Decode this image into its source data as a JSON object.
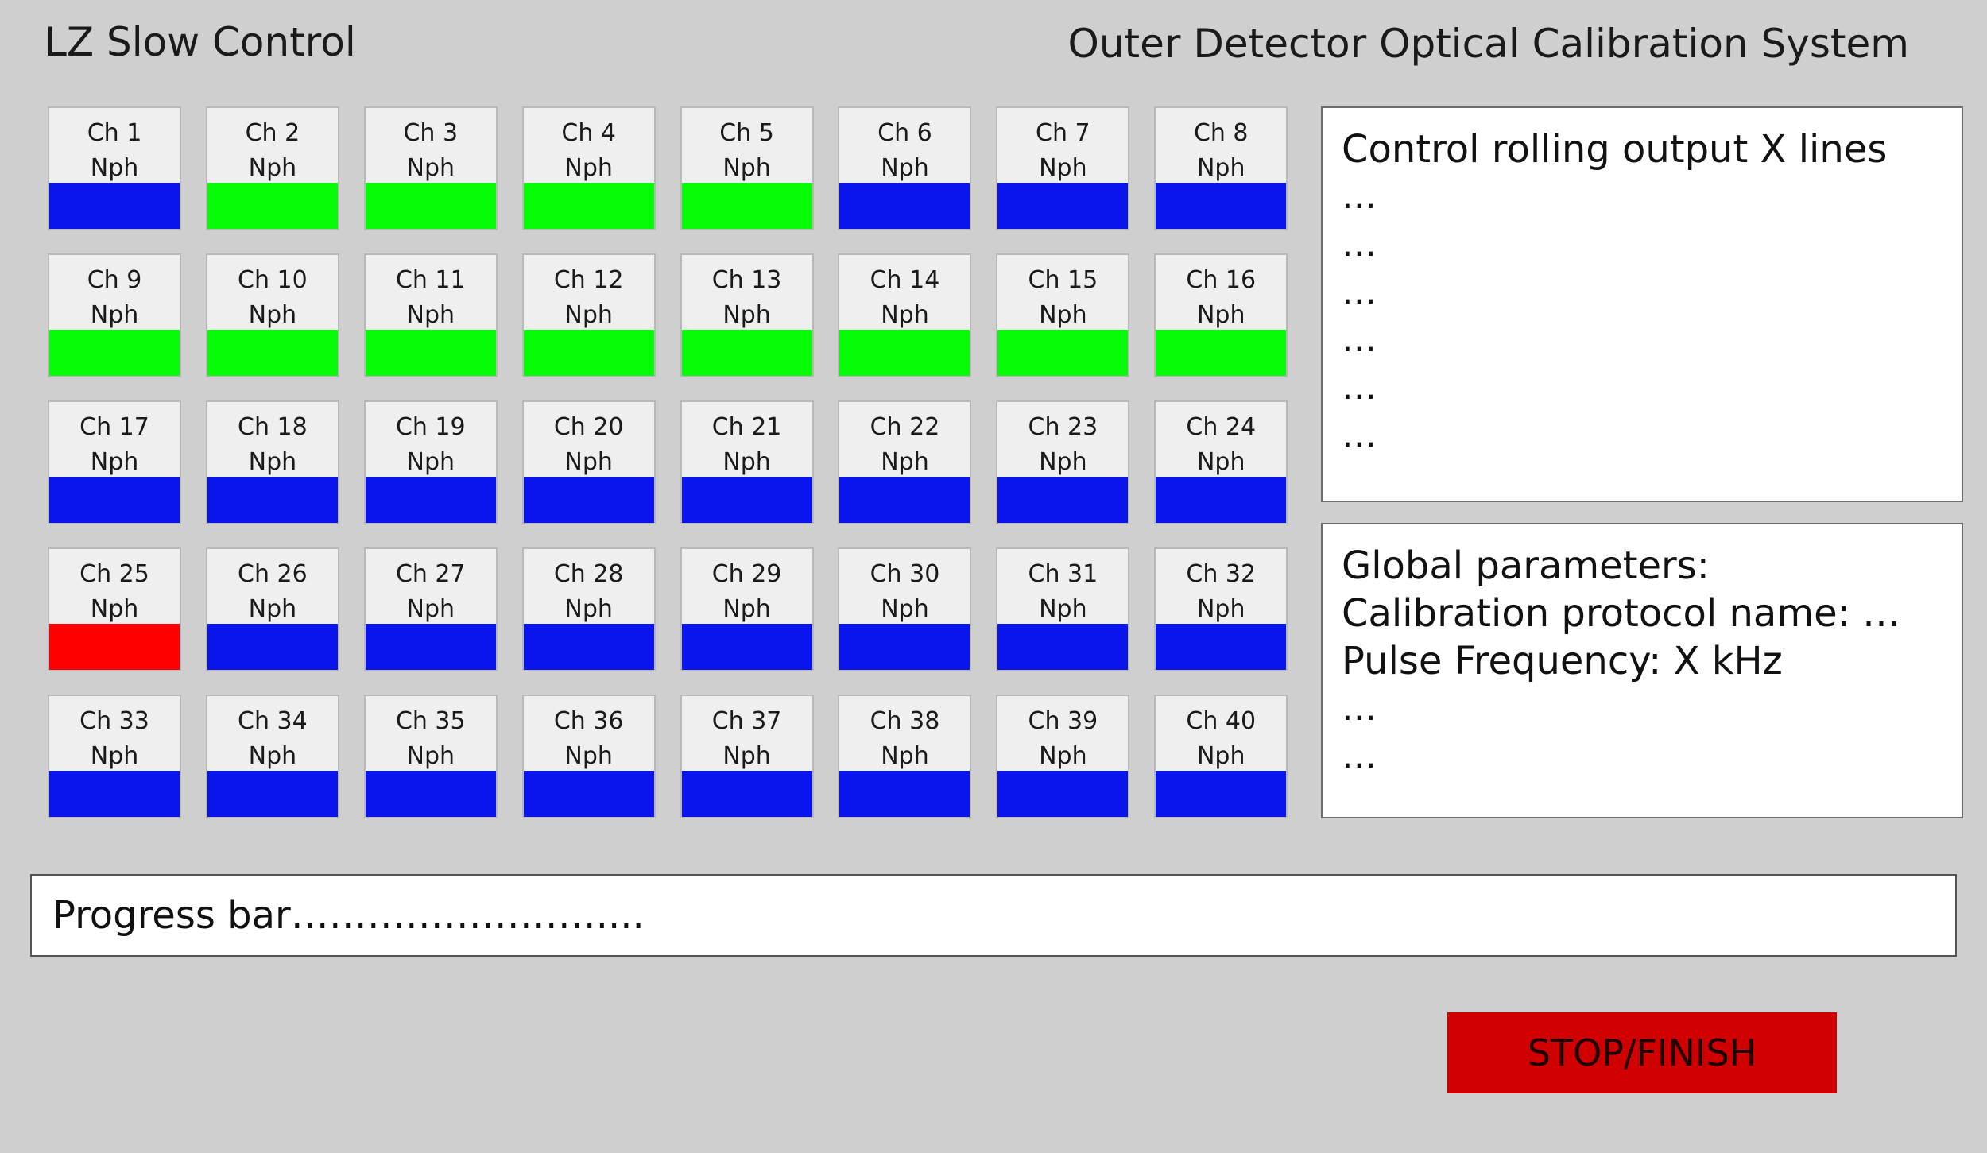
{
  "header": {
    "app_title": "LZ Slow Control",
    "system_title": "Outer Detector Optical Calibration System"
  },
  "colors": {
    "blue": "#0a14ec",
    "green": "#06fb06",
    "red": "#fe0000",
    "stop_button": "#d10000"
  },
  "channels": [
    {
      "label": "Ch 1",
      "unit": "Nph",
      "status": "blue"
    },
    {
      "label": "Ch 2",
      "unit": "Nph",
      "status": "green"
    },
    {
      "label": "Ch 3",
      "unit": "Nph",
      "status": "green"
    },
    {
      "label": "Ch 4",
      "unit": "Nph",
      "status": "green"
    },
    {
      "label": "Ch 5",
      "unit": "Nph",
      "status": "green"
    },
    {
      "label": "Ch 6",
      "unit": "Nph",
      "status": "blue"
    },
    {
      "label": "Ch 7",
      "unit": "Nph",
      "status": "blue"
    },
    {
      "label": "Ch 8",
      "unit": "Nph",
      "status": "blue"
    },
    {
      "label": "Ch 9",
      "unit": "Nph",
      "status": "green"
    },
    {
      "label": "Ch 10",
      "unit": "Nph",
      "status": "green"
    },
    {
      "label": "Ch 11",
      "unit": "Nph",
      "status": "green"
    },
    {
      "label": "Ch 12",
      "unit": "Nph",
      "status": "green"
    },
    {
      "label": "Ch 13",
      "unit": "Nph",
      "status": "green"
    },
    {
      "label": "Ch 14",
      "unit": "Nph",
      "status": "green"
    },
    {
      "label": "Ch 15",
      "unit": "Nph",
      "status": "green"
    },
    {
      "label": "Ch 16",
      "unit": "Nph",
      "status": "green"
    },
    {
      "label": "Ch 17",
      "unit": "Nph",
      "status": "blue"
    },
    {
      "label": "Ch 18",
      "unit": "Nph",
      "status": "blue"
    },
    {
      "label": "Ch 19",
      "unit": "Nph",
      "status": "blue"
    },
    {
      "label": "Ch 20",
      "unit": "Nph",
      "status": "blue"
    },
    {
      "label": "Ch 21",
      "unit": "Nph",
      "status": "blue"
    },
    {
      "label": "Ch 22",
      "unit": "Nph",
      "status": "blue"
    },
    {
      "label": "Ch 23",
      "unit": "Nph",
      "status": "blue"
    },
    {
      "label": "Ch 24",
      "unit": "Nph",
      "status": "blue"
    },
    {
      "label": "Ch 25",
      "unit": "Nph",
      "status": "red"
    },
    {
      "label": "Ch 26",
      "unit": "Nph",
      "status": "blue"
    },
    {
      "label": "Ch 27",
      "unit": "Nph",
      "status": "blue"
    },
    {
      "label": "Ch 28",
      "unit": "Nph",
      "status": "blue"
    },
    {
      "label": "Ch 29",
      "unit": "Nph",
      "status": "blue"
    },
    {
      "label": "Ch 30",
      "unit": "Nph",
      "status": "blue"
    },
    {
      "label": "Ch 31",
      "unit": "Nph",
      "status": "blue"
    },
    {
      "label": "Ch 32",
      "unit": "Nph",
      "status": "blue"
    },
    {
      "label": "Ch 33",
      "unit": "Nph",
      "status": "blue"
    },
    {
      "label": "Ch 34",
      "unit": "Nph",
      "status": "blue"
    },
    {
      "label": "Ch 35",
      "unit": "Nph",
      "status": "blue"
    },
    {
      "label": "Ch 36",
      "unit": "Nph",
      "status": "blue"
    },
    {
      "label": "Ch 37",
      "unit": "Nph",
      "status": "blue"
    },
    {
      "label": "Ch 38",
      "unit": "Nph",
      "status": "blue"
    },
    {
      "label": "Ch 39",
      "unit": "Nph",
      "status": "blue"
    },
    {
      "label": "Ch 40",
      "unit": "Nph",
      "status": "blue"
    }
  ],
  "output_panel": {
    "lines": [
      "Control rolling output X lines",
      "…",
      "…",
      "…",
      "…",
      "…",
      "…"
    ]
  },
  "params_panel": {
    "lines": [
      "Global parameters:",
      "Calibration protocol name: …",
      "Pulse Frequency: X kHz",
      "…",
      "…"
    ]
  },
  "progress": {
    "label": "Progress bar……………………...."
  },
  "actions": {
    "stop_label": "STOP/FINISH"
  }
}
